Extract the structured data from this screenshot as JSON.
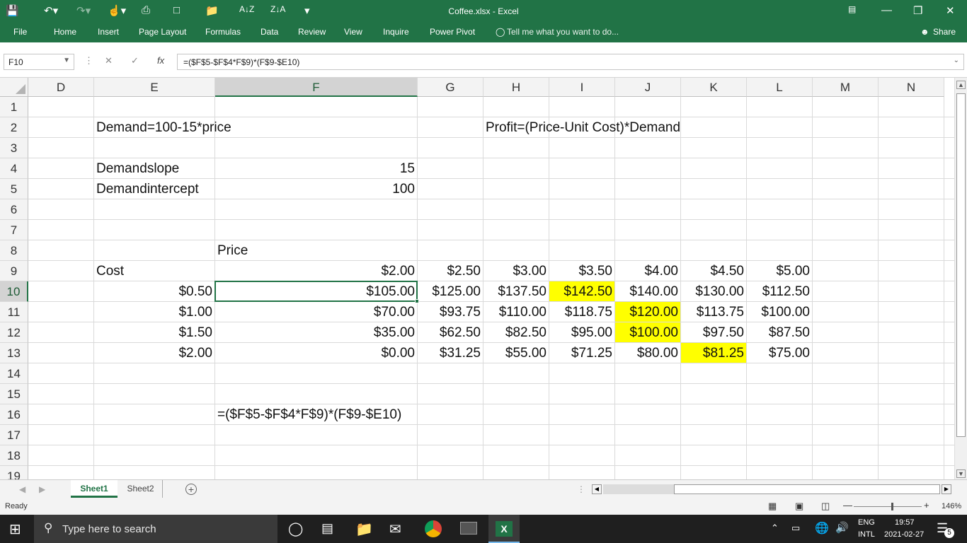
{
  "window": {
    "title": "Coffee.xlsx  -  Excel"
  },
  "ribbon": {
    "tabs": [
      "File",
      "Home",
      "Insert",
      "Page Layout",
      "Formulas",
      "Data",
      "Review",
      "View",
      "Inquire",
      "Power Pivot"
    ],
    "tell_me": "Tell me what you want to do...",
    "share": "Share"
  },
  "formula_bar": {
    "name_box": "F10",
    "formula": "=($F$5-$F$4*F$9)*(F$9-$E10)"
  },
  "columns": [
    "D",
    "E",
    "F",
    "G",
    "H",
    "I",
    "J",
    "K",
    "L",
    "M",
    "N"
  ],
  "rows": [
    "1",
    "2",
    "3",
    "4",
    "5",
    "6",
    "7",
    "8",
    "9",
    "10",
    "11",
    "12",
    "13",
    "14",
    "15",
    "16",
    "17",
    "18",
    "19"
  ],
  "cells": {
    "E2": "Demand=100-15*price",
    "H2": "Profit=(Price-Unit Cost)*Demand",
    "E4": "Demandslope",
    "F4": "15",
    "E5": "Demandintercept",
    "F5": "100",
    "F8": "Price",
    "E9": "Cost",
    "F9": "$2.00",
    "G9": "$2.50",
    "H9": "$3.00",
    "I9": "$3.50",
    "J9": "$4.00",
    "K9": "$4.50",
    "L9": "$5.00",
    "E10": "$0.50",
    "F10": "$105.00",
    "G10": "$125.00",
    "H10": "$137.50",
    "I10": "$142.50",
    "J10": "$140.00",
    "K10": "$130.00",
    "L10": "$112.50",
    "E11": "$1.00",
    "F11": "$70.00",
    "G11": "$93.75",
    "H11": "$110.00",
    "I11": "$118.75",
    "J11": "$120.00",
    "K11": "$113.75",
    "L11": "$100.00",
    "E12": "$1.50",
    "F12": "$35.00",
    "G12": "$62.50",
    "H12": "$82.50",
    "I12": "$95.00",
    "J12": "$100.00",
    "K12": "$97.50",
    "L12": "$87.50",
    "E13": "$2.00",
    "F13": "$0.00",
    "G13": "$31.25",
    "H13": "$55.00",
    "I13": "$71.25",
    "J13": "$80.00",
    "K13": "$81.25",
    "L13": "$75.00",
    "F16": "=($F$5-$F$4*F$9)*(F$9-$E10)"
  },
  "highlight_color": "#ffff00",
  "sheets": [
    "Sheet1",
    "Sheet2"
  ],
  "status": {
    "ready": "Ready",
    "zoom": "146%"
  },
  "taskbar": {
    "search_placeholder": "Type here to search",
    "lang": "ENG",
    "lang2": "INTL",
    "time": "19:57",
    "date": "2021-02-27",
    "notifications": "5"
  }
}
